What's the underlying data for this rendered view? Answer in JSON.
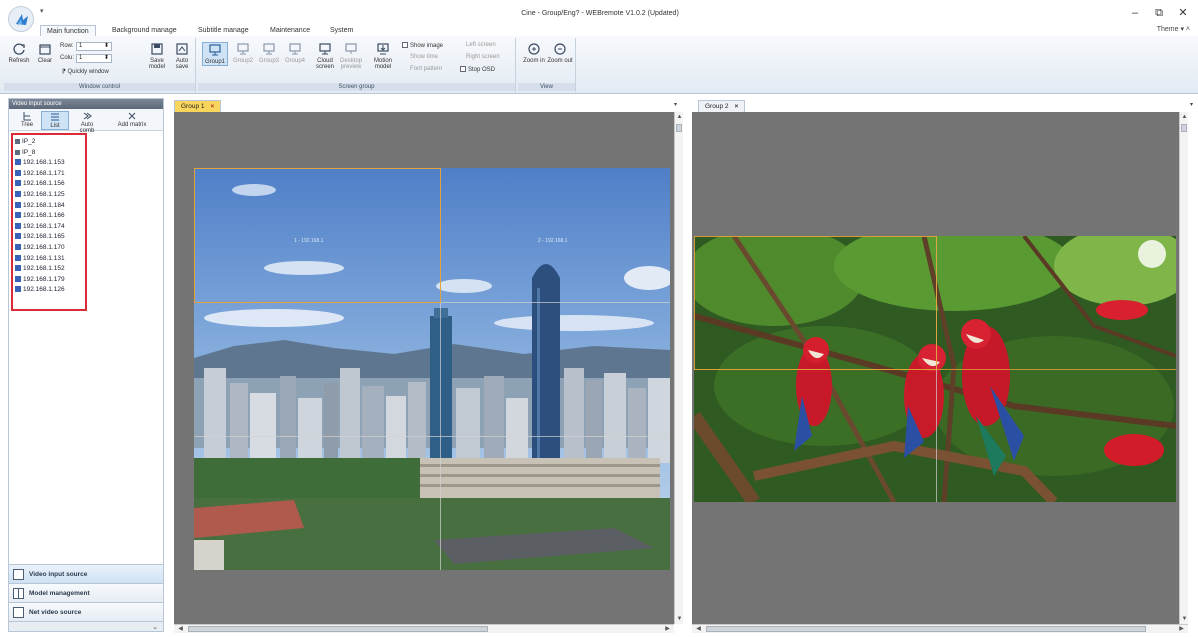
{
  "window": {
    "title": "Cine - Group/Eng? - WEBremote V1.0.2 (Updated)",
    "theme_label": "Theme"
  },
  "ribbon_tabs": [
    {
      "label": "Main function",
      "active": true
    },
    {
      "label": "Background manage",
      "active": false
    },
    {
      "label": "Subtitle manage",
      "active": false
    },
    {
      "label": "Maintenance",
      "active": false
    },
    {
      "label": "System",
      "active": false
    }
  ],
  "ribbon": {
    "window_control": {
      "refresh": "Refresh",
      "clear": "Clear",
      "row_label": "Row:",
      "row_value": "1",
      "column_label": "Colu:",
      "column_value": "1",
      "quickly_window": "Quickly window",
      "save_model": "Save model",
      "auto_save": "Auto save",
      "group_label": "Window control"
    },
    "screen_group": {
      "group1": "Group1",
      "group2": "Group2",
      "group3": "Group3",
      "group4": "Group4",
      "cloud_screen": "Cloud screen",
      "desktop_preview": "Desktop preview",
      "motion_model": "Motion model",
      "show_image": "Show image",
      "show_time": "Show time",
      "font_pattern": "Font pattern",
      "left_screen": "Left screen",
      "right_screen": "Right screen",
      "stop_osd": "Stop OSD",
      "group_label": "Screen group"
    },
    "view": {
      "zoom_in": "Zoom in",
      "zoom_out": "Zoom out",
      "group_label": "View"
    }
  },
  "left_panel": {
    "header": "Video input source",
    "tools": [
      "Tree",
      "List",
      "Auto comb",
      "Add matrix"
    ],
    "sources": [
      {
        "label": "IP_2",
        "type": "folder"
      },
      {
        "label": "IP_8",
        "type": "folder"
      },
      {
        "label": "192.168.1.153",
        "type": "source"
      },
      {
        "label": "192.168.1.171",
        "type": "source"
      },
      {
        "label": "192.168.1.156",
        "type": "source"
      },
      {
        "label": "192.168.1.125",
        "type": "source"
      },
      {
        "label": "192.168.1.184",
        "type": "source"
      },
      {
        "label": "192.168.1.166",
        "type": "source"
      },
      {
        "label": "192.168.1.174",
        "type": "source"
      },
      {
        "label": "192.168.1.165",
        "type": "source"
      },
      {
        "label": "192.168.1.170",
        "type": "source"
      },
      {
        "label": "192.168.1.131",
        "type": "source"
      },
      {
        "label": "192.168.1.152",
        "type": "source"
      },
      {
        "label": "192.168.1.179",
        "type": "source"
      },
      {
        "label": "192.168.1.126",
        "type": "source"
      }
    ],
    "nav": [
      {
        "label": "Video input source",
        "active": true
      },
      {
        "label": "Model management",
        "active": false
      },
      {
        "label": "Net video source",
        "active": false
      }
    ]
  },
  "documents": [
    {
      "tab": "Group 1",
      "active": true
    },
    {
      "tab": "Group 2",
      "active": false
    }
  ],
  "group1": {
    "window_ids": [
      "1 - 192.168.1",
      "2 - 192.168.1"
    ]
  },
  "colors": {
    "active_tab": "#f9d65b",
    "canvas_bg": "#747474",
    "highlight_border": "#d92c38",
    "window_border": "#e3a23a"
  }
}
